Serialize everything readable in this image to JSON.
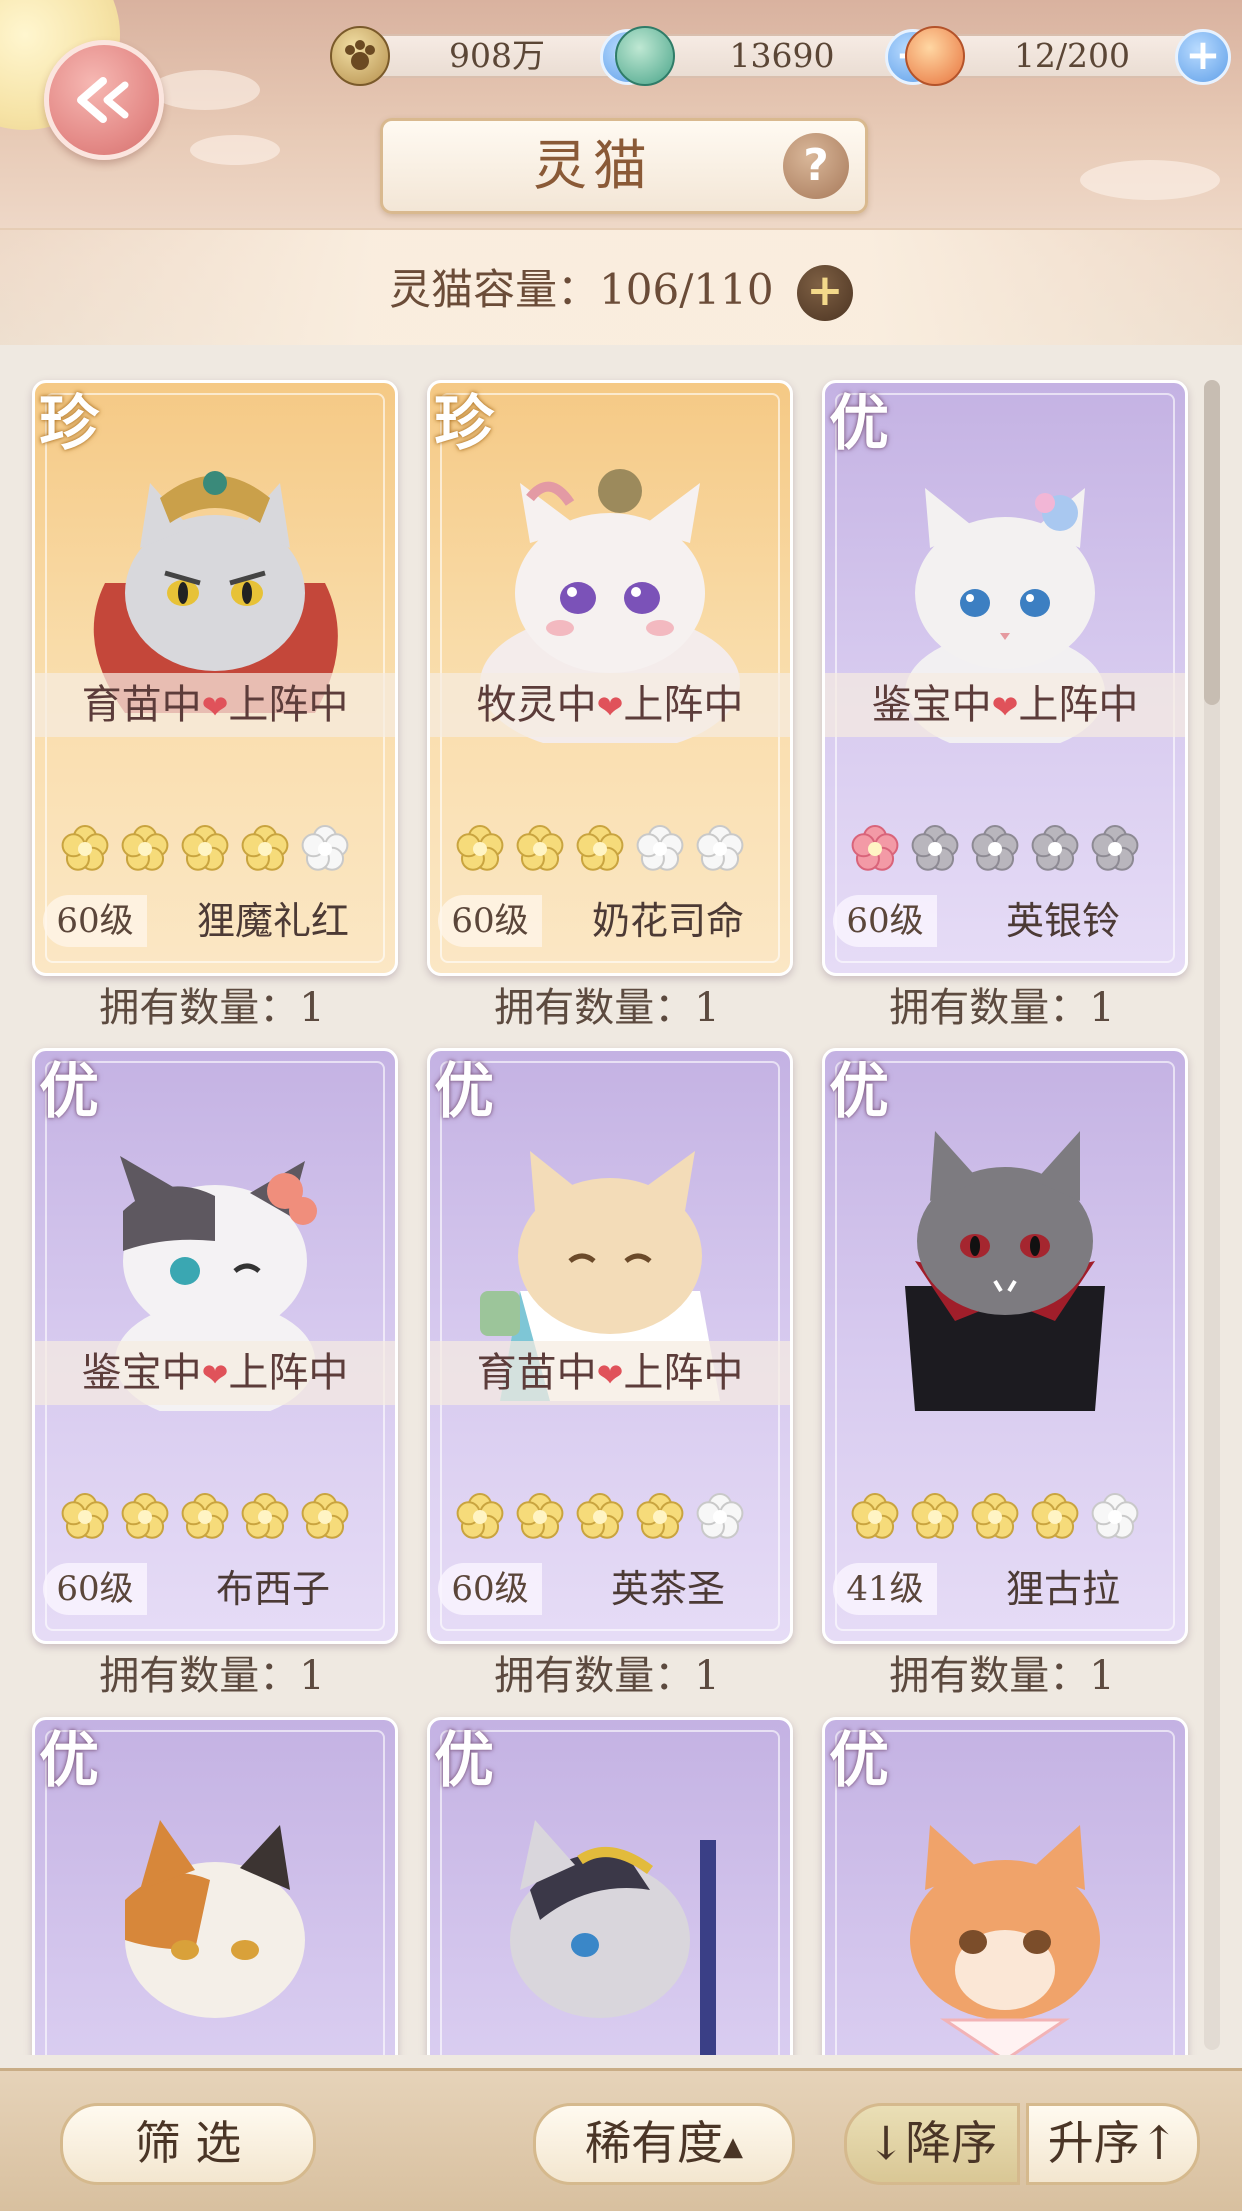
{
  "header": {
    "title": "灵猫",
    "help_label": "?",
    "resources": [
      {
        "icon": "paw-coin-icon",
        "value": "908万"
      },
      {
        "icon": "jade-gem-icon",
        "value": "13690"
      },
      {
        "icon": "food-bowl-icon",
        "value": "12/200"
      }
    ],
    "plus_label": "+",
    "capacity_label": "灵猫容量：106/110",
    "capacity_plus": "+"
  },
  "cards": [
    {
      "rarity": "珍",
      "status_a": "育苗中",
      "status_b": "上阵中",
      "level": "60级",
      "name": "狸魔礼红",
      "stars": 4,
      "owned": "拥有数量：1"
    },
    {
      "rarity": "珍",
      "status_a": "牧灵中",
      "status_b": "上阵中",
      "level": "60级",
      "name": "奶花司命",
      "stars": 3,
      "owned": "拥有数量：1"
    },
    {
      "rarity": "优",
      "status_a": "鉴宝中",
      "status_b": "上阵中",
      "level": "60级",
      "name": "英银铃",
      "stars": 1,
      "owned": "拥有数量：1"
    },
    {
      "rarity": "优",
      "status_a": "鉴宝中",
      "status_b": "上阵中",
      "level": "60级",
      "name": "布西子",
      "stars": 5,
      "owned": "拥有数量：1"
    },
    {
      "rarity": "优",
      "status_a": "育苗中",
      "status_b": "上阵中",
      "level": "60级",
      "name": "英茶圣",
      "stars": 4,
      "owned": "拥有数量：1"
    },
    {
      "rarity": "优",
      "level": "41级",
      "name": "狸古拉",
      "stars": 4,
      "owned": "拥有数量：1"
    },
    {
      "rarity": "优"
    },
    {
      "rarity": "优"
    },
    {
      "rarity": "优"
    }
  ],
  "bottom": {
    "filter": "筛 选",
    "sort": "稀有度",
    "desc": "↓降序",
    "asc": "升序↑"
  },
  "colors": {
    "gold_card": "#f7d29a",
    "purple_card": "#d0c1ec",
    "plus_blue": "#5f9fe8",
    "heart": "#e0525a"
  }
}
